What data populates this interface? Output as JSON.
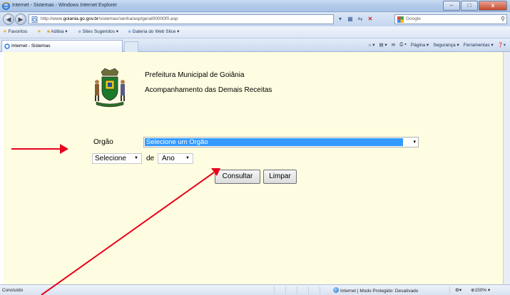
{
  "window": {
    "title": "Internet - Sistemas - Windows Internet Explorer",
    "minimize": "–",
    "maximize": "□",
    "close": "x"
  },
  "address": {
    "url_prefix": "http://www.",
    "url_domain": "goiania.go.gov.br",
    "url_path": "/sistemas/senha/asp/geral00000f0.asp",
    "search_placeholder": "Google"
  },
  "favorites_bar": {
    "favorites": "Favoritos",
    "adibia": "Adibia ▾",
    "sites": "Sites Sugeridos ▾",
    "gallery": "Galeria do Web Slice ▾"
  },
  "tabs": [
    {
      "label": "Internet - Sistemas"
    }
  ],
  "command_bar": {
    "page": "Página ▾",
    "security": "Segurança ▾",
    "tools": "Ferramentas ▾"
  },
  "page": {
    "org_name": "Prefeitura Municipal de Goiânia",
    "subtitle": "Acompanhamento das Demais Receitas",
    "orgao_label": "Orgão",
    "orgao_select": "Selecione um Orgão",
    "month_select": "Selecione",
    "de_label": "de",
    "year_select": "Ano",
    "consultar_button": "Consultar",
    "limpar_button": "Limpar"
  },
  "status": {
    "left": "Concluído",
    "zone": "Internet | Modo Protegido: Desativado",
    "zoom": "150%"
  },
  "colors": {
    "page_background": "#fffde1",
    "selection": "#3399ff",
    "annotation_arrow": "#e8001c"
  }
}
